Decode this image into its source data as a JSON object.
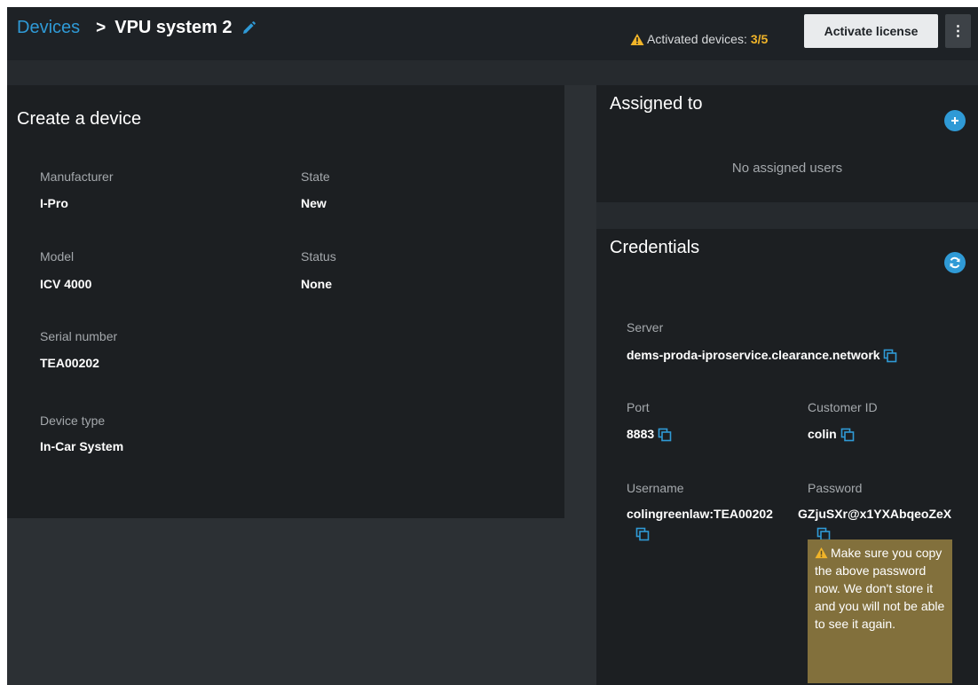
{
  "header": {
    "breadcrumb_parent": "Devices",
    "breadcrumb_separator": ">",
    "device_name": "VPU system 2",
    "activated_label": "Activated devices:",
    "activated_count": "3/5",
    "activate_button": "Activate license",
    "menu_icon": "⋮"
  },
  "device": {
    "title": "Create a device",
    "manufacturer_label": "Manufacturer",
    "manufacturer_value": "I-Pro",
    "state_label": "State",
    "state_value": "New",
    "model_label": "Model",
    "model_value": "ICV 4000",
    "status_label": "Status",
    "status_value": "None",
    "serial_label": "Serial number",
    "serial_value": "TEA00202",
    "type_label": "Device type",
    "type_value": "In-Car System"
  },
  "assigned": {
    "title": "Assigned to",
    "empty_text": "No assigned users"
  },
  "credentials": {
    "title": "Credentials",
    "server_label": "Server",
    "server_value": "dems-proda-iproservice.clearance.network",
    "port_label": "Port",
    "port_value": "8883",
    "customer_label": "Customer ID",
    "customer_value": "colin",
    "username_label": "Username",
    "username_value": "colingreenlaw:TEA00202",
    "password_label": "Password",
    "password_value": "GZjuSXr@x1YXAbqeoZeX",
    "warning_text": "Make sure you copy the above password now. We don't store it and you will not be able to see it again."
  },
  "colors": {
    "accent": "#2f9ad6",
    "warning": "#f0b429",
    "warning_box": "#82703c",
    "panel": "#1c1f22",
    "background": "#2c3034"
  },
  "icons": {
    "edit": "pencil-icon",
    "warning": "warning-triangle-icon",
    "add": "plus-icon",
    "refresh": "refresh-icon",
    "copy": "copy-icon",
    "menu": "kebab-menu-icon"
  }
}
